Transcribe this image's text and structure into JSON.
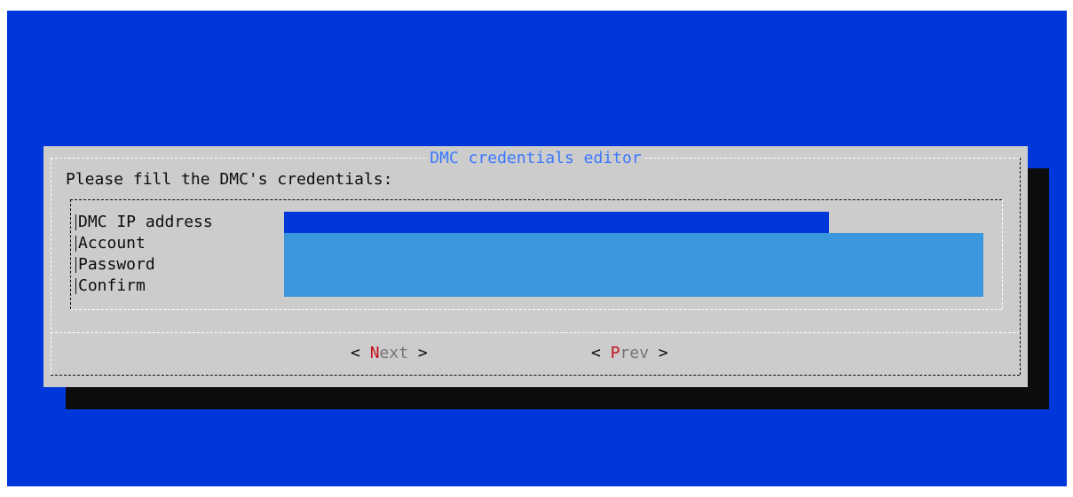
{
  "dialog": {
    "title": "DMC credentials editor",
    "prompt": "Please fill the DMC's credentials:"
  },
  "form": {
    "fields": [
      {
        "label": "DMC IP address",
        "value": ""
      },
      {
        "label": "Account",
        "value": ""
      },
      {
        "label": "Password",
        "value": ""
      },
      {
        "label": "Confirm",
        "value": ""
      }
    ]
  },
  "buttons": {
    "next": {
      "left": "< ",
      "hotkey": "N",
      "rest": "ext",
      "right": " >"
    },
    "prev": {
      "left": "< ",
      "hotkey": "P",
      "rest": "rev",
      "right": " >"
    }
  },
  "colors": {
    "background": "#0037da",
    "dialog": "#cccccc",
    "title": "#3b78ff",
    "active_field": "#0037da",
    "idle_field": "#3a96dd",
    "hotkey": "#c50f1f"
  }
}
